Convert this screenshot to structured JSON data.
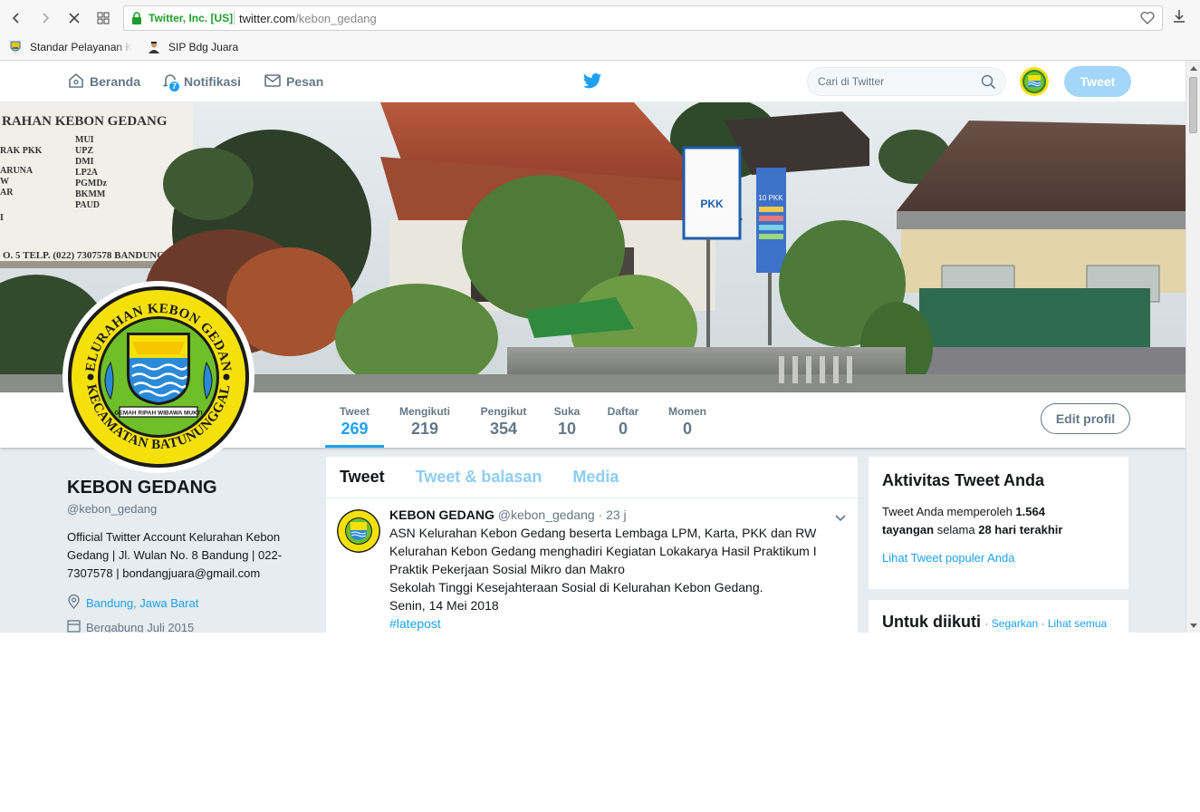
{
  "browser": {
    "ev_label": "Twitter, Inc. [US]",
    "url_host": "twitter.com",
    "url_path": "/kebon_gedang",
    "bookmarks": [
      {
        "label": "Standar Pelayanan Ke"
      },
      {
        "label": "SIP Bdg Juara"
      }
    ],
    "icons": [
      "back-icon",
      "forward-icon",
      "stop-icon",
      "grid-icon",
      "lock-icon",
      "heart-icon",
      "download-icon"
    ]
  },
  "topnav": {
    "items": [
      {
        "label": "Beranda",
        "icon": "home-icon"
      },
      {
        "label": "Notifikasi",
        "icon": "bell-icon",
        "badge": "7"
      },
      {
        "label": "Pesan",
        "icon": "envelope-icon"
      }
    ],
    "search_placeholder": "Cari di Twitter",
    "tweet_button": "Tweet"
  },
  "profile_nav": {
    "stats": [
      {
        "label": "Tweet",
        "value": "269"
      },
      {
        "label": "Mengikuti",
        "value": "219"
      },
      {
        "label": "Pengikut",
        "value": "354"
      },
      {
        "label": "Suka",
        "value": "10"
      },
      {
        "label": "Daftar",
        "value": "0"
      },
      {
        "label": "Momen",
        "value": "0"
      }
    ],
    "edit_button": "Edit profil"
  },
  "profile": {
    "name": "KEBON GEDANG",
    "handle": "@kebon_gedang",
    "bio": "Official Twitter Account Kelurahan Kebon Gedang | Jl. Wulan No. 8 Bandung | 022-7307578 | bondangjuara@gmail.com",
    "location": "Bandung, Jawa Barat",
    "joined": "Bergabung Juli 2015",
    "logo_text_top": "KELURAHAN KEBON GEDANG",
    "logo_text_bottom": "KECAMATAN BATUNUNGGAL",
    "logo_motto": "GEMAH RIPAH WIBAWA MUKTI"
  },
  "header_photo": {
    "board_title": "RAHAN KEBON GEDANG",
    "board_items": [
      "MUI",
      "UPZ",
      "DMI",
      "LP2A",
      "PGMDz",
      "BKMM",
      "PAUD"
    ],
    "board_left": [
      "RAK PKK",
      "ARUNA",
      "W",
      "AR",
      "I"
    ],
    "board_footer": "O. 5 TELP. (022) 7307578 BANDUNG",
    "sign_text": "PKK",
    "sign2_text": "10 PKK"
  },
  "timeline": {
    "tabs": [
      "Tweet",
      "Tweet & balasan",
      "Media"
    ],
    "tweet": {
      "name": "KEBON GEDANG",
      "handle": "@kebon_gedang",
      "time": "· 23 j",
      "text": "ASN Kelurahan Kebon Gedang beserta Lembaga LPM, Karta, PKK dan RW Kelurahan Kebon Gedang menghadiri Kegiatan Lokakarya Hasil Praktikum I Praktik Pekerjaan Sosial Mikro dan Makro\nSekolah Tinggi Kesejahteraan Sosial di Kelurahan Kebon Gedang.\nSenin, 14 Mei 2018",
      "hashtag": "#latepost"
    }
  },
  "sidebar": {
    "activity": {
      "title": "Aktivitas Tweet Anda",
      "text_a": "Tweet Anda memperoleh ",
      "impressions": "1.564",
      "text_b": "tayangan",
      "text_c": " selama ",
      "period": "28 hari terakhir",
      "link": "Lihat Tweet populer Anda"
    },
    "follow": {
      "title": "Untuk diikuti",
      "refresh": "Segarkan",
      "view_all": "Lihat semua"
    }
  },
  "colors": {
    "twitter_blue": "#1da1f2",
    "logo_green": "#6fbf2a",
    "logo_yellow": "#f5e10a"
  }
}
